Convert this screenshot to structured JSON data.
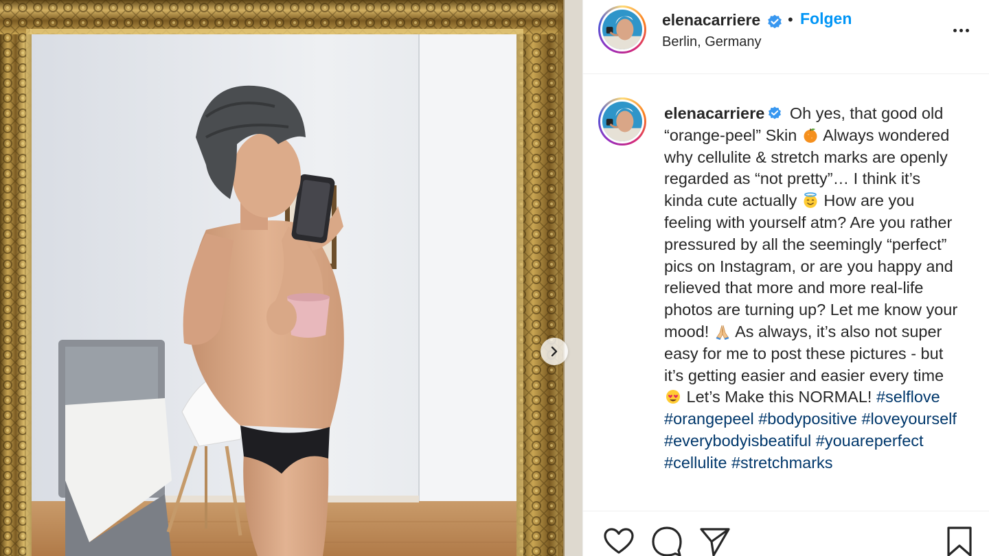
{
  "post": {
    "username": "elenacarriere",
    "separator": "•",
    "follow_label": "Folgen",
    "location": "Berlin, Germany",
    "verified": true
  },
  "caption": {
    "username": "elenacarriere",
    "segments": [
      {
        "t": "text",
        "v": " Oh yes, that good old “orange-peel” Skin "
      },
      {
        "t": "emoji",
        "name": "orange-emoji"
      },
      {
        "t": "text",
        "v": " Always wondered why cellulite & stretch marks are openly regarded as “not pretty”… I think it’s kinda cute actually "
      },
      {
        "t": "emoji",
        "name": "smiling-face-with-halo-emoji"
      },
      {
        "t": "text",
        "v": " How are you feeling with yourself atm? Are you rather pressured by all the seemingly “perfect” pics on Instagram, or are you happy and relieved that more and more real-life photos are turning up? Let me know your mood! "
      },
      {
        "t": "emoji",
        "name": "folded-hands-emoji"
      },
      {
        "t": "text",
        "v": " As always, it’s also not super easy for me to post these pictures - but it’s getting easier and easier every time "
      },
      {
        "t": "emoji",
        "name": "heart-eyes-emoji"
      },
      {
        "t": "text",
        "v": " Let’s Make this NORMAL! "
      },
      {
        "t": "tag",
        "v": "#selflove"
      },
      {
        "t": "text",
        "v": " "
      },
      {
        "t": "tag",
        "v": "#orangepeel"
      },
      {
        "t": "text",
        "v": " "
      },
      {
        "t": "tag",
        "v": "#bodypositive"
      },
      {
        "t": "text",
        "v": " "
      },
      {
        "t": "tag",
        "v": "#loveyourself"
      },
      {
        "t": "text",
        "v": " "
      },
      {
        "t": "tag",
        "v": "#everybodyisbeatiful"
      },
      {
        "t": "text",
        "v": " "
      },
      {
        "t": "tag",
        "v": "#youareperfect"
      },
      {
        "t": "text",
        "v": " "
      },
      {
        "t": "tag",
        "v": "#cellulite"
      },
      {
        "t": "text",
        "v": " "
      },
      {
        "t": "tag",
        "v": "#stretchmarks"
      }
    ]
  },
  "media": {
    "next_icon": "chevron-right-icon"
  },
  "actions": {
    "icons": [
      "heart-icon",
      "comment-icon",
      "share-icon",
      "bookmark-icon"
    ]
  },
  "colors": {
    "accent": "#0095f6",
    "hashtag": "#00376b",
    "verified": "#3897f0",
    "text": "#262626",
    "divider": "#efefef"
  }
}
